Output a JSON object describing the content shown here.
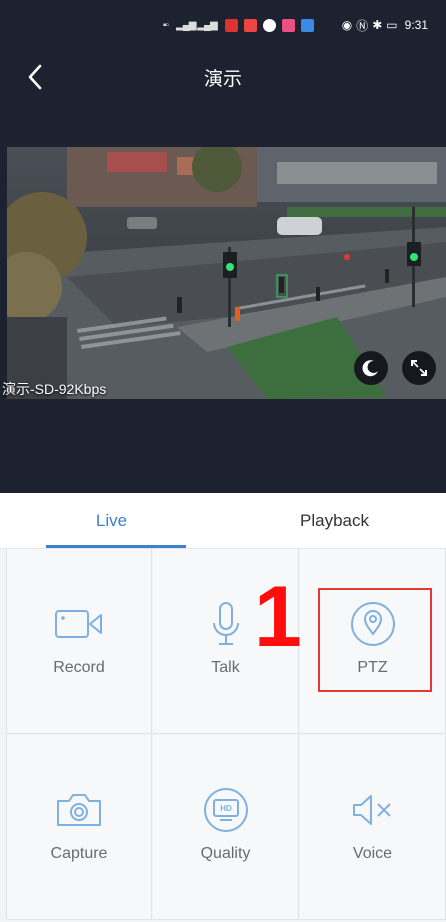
{
  "status_bar": {
    "time": "9:31"
  },
  "header": {
    "title": "演示",
    "back_icon": "chevron-left-icon"
  },
  "video": {
    "overlay_label": "演示-SD-92Kbps"
  },
  "tabs": [
    {
      "label": "Live",
      "active": true
    },
    {
      "label": "Playback",
      "active": false
    }
  ],
  "controls": [
    {
      "label": "Record",
      "icon": "video-camera-icon"
    },
    {
      "label": "Talk",
      "icon": "microphone-icon"
    },
    {
      "label": "PTZ",
      "icon": "location-pin-icon"
    },
    {
      "label": "Capture",
      "icon": "camera-icon"
    },
    {
      "label": "Quality",
      "icon": "hd-monitor-icon"
    },
    {
      "label": "Voice",
      "icon": "speaker-muted-icon"
    }
  ],
  "annotation": {
    "number": "1"
  },
  "colors": {
    "accent": "#3a82d0",
    "annotation": "#e53935",
    "dark_bg": "#1d2230"
  }
}
